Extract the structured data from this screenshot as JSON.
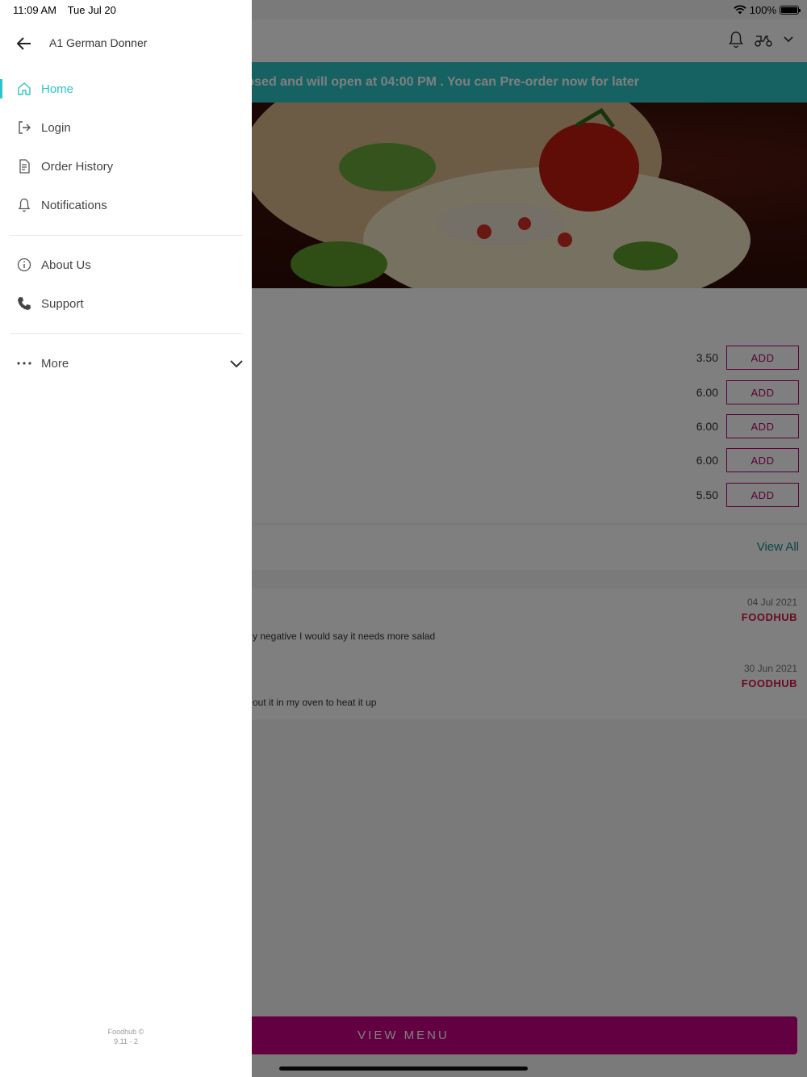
{
  "status": {
    "time": "11:09 AM",
    "date": "Tue Jul 20",
    "battery": "100%"
  },
  "app": {
    "banner": "osed and will open at 04:00 PM . You can Pre-order now for later",
    "menu_items": [
      {
        "price": "3.50",
        "action": "ADD"
      },
      {
        "price": "6.00",
        "action": "ADD"
      },
      {
        "price": "6.00",
        "action": "ADD"
      },
      {
        "price": "6.00",
        "action": "ADD"
      },
      {
        "price": "5.50",
        "action": "ADD"
      }
    ],
    "reviews_link": "View All",
    "reviews": [
      {
        "date": "04 Jul 2021",
        "source": "FOODHUB",
        "text": "y negative I would say it needs more salad"
      },
      {
        "date": "30 Jun 2021",
        "source": "FOODHUB",
        "text": "out it in my oven to heat it up"
      }
    ],
    "cta": "VIEW MENU"
  },
  "drawer": {
    "title": "A1 German Donner",
    "items": [
      {
        "label": "Home",
        "icon": "home-icon",
        "active": true
      },
      {
        "label": "Login",
        "icon": "login-icon"
      },
      {
        "label": "Order History",
        "icon": "receipt-icon"
      },
      {
        "label": "Notifications",
        "icon": "bell-icon"
      },
      {
        "label": "About Us",
        "icon": "info-icon"
      },
      {
        "label": "Support",
        "icon": "phone-icon"
      },
      {
        "label": "More",
        "icon": "dots-icon"
      }
    ],
    "footer_brand": "Foodhub ©",
    "footer_version": "9.11 - 2"
  },
  "colors": {
    "accent": "#2cc4c6",
    "brand": "#c40084",
    "add_border": "#b8006e",
    "foodhub_red": "#d6163c"
  }
}
